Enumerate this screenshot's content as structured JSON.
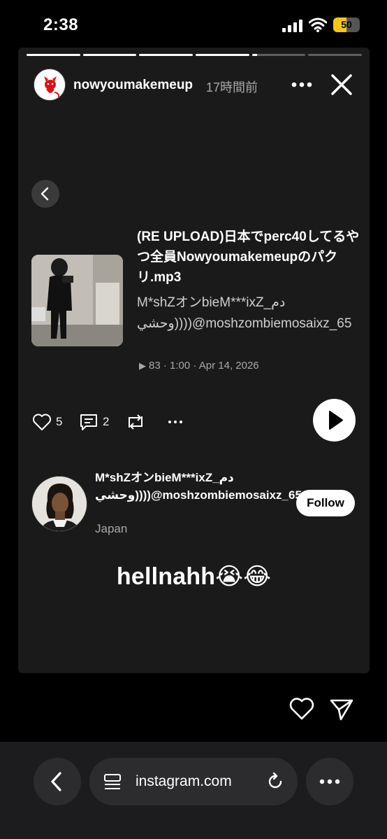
{
  "status_bar": {
    "time": "2:38",
    "battery": "50"
  },
  "story": {
    "progress_fractions": [
      1,
      1,
      1,
      1,
      0.1,
      0
    ],
    "username": "nowyoumakemeup",
    "time_ago": "17時間前",
    "track": {
      "title": "(RE UPLOAD)日本でperc40してるやつ全員Nowyoumakemeupのパクリ.mp3",
      "artist": "M*shZオンbieM***ixZ_دم وحشي))))@moshzombiemosaixz_65",
      "plays": "83",
      "duration": "1:00",
      "date": "Apr 14, 2026"
    },
    "actions": {
      "likes": "5",
      "comments": "2"
    },
    "creator": {
      "name": "M*shZオンbieM***ixZ_دم وحشي))))@moshzombiemosaixz_65",
      "location": "Japan",
      "follow_label": "Follow"
    },
    "caption": "hellnahh😭😂"
  },
  "browser": {
    "url": "instagram.com"
  },
  "icons": {
    "signal": "signal-icon",
    "wifi": "wifi-icon",
    "battery": "battery-icon",
    "more": "more-icon",
    "close": "close-icon",
    "back": "chevron-left-icon",
    "heart": "heart-icon",
    "comment": "comment-icon",
    "repost": "repost-icon",
    "play": "play-icon",
    "share": "send-icon",
    "page": "page-icon",
    "reload": "reload-icon"
  }
}
